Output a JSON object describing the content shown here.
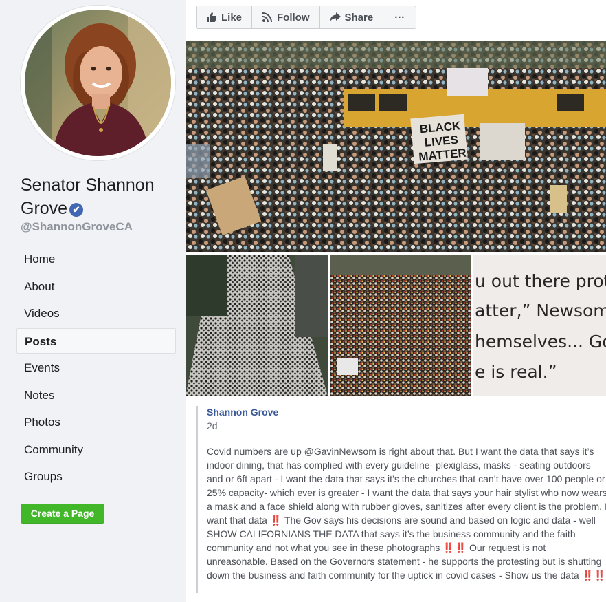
{
  "sidebar": {
    "page_name": "Senator Shannon Grove",
    "verified_badge": "✔",
    "handle": "@ShannonGroveCA",
    "nav": [
      "Home",
      "About",
      "Videos",
      "Posts",
      "Events",
      "Notes",
      "Photos",
      "Community",
      "Groups"
    ],
    "active_nav": "Posts",
    "create_page_label": "Create a Page"
  },
  "actions": {
    "like": "Like",
    "follow": "Follow",
    "share": "Share",
    "more": "···"
  },
  "photos": {
    "main_sign": [
      "BLACK",
      "LIVES",
      "MATTER"
    ],
    "quote_lines": [
      "u out there prote",
      "atter,” Newsom s",
      "hemselves... God",
      "e is real.”"
    ]
  },
  "post": {
    "author": "Shannon Grove",
    "time": "2d",
    "text": "Covid numbers are up @GavinNewsom is right about that. But I want the data that says it’s indoor dining, that has complied with every guideline- plexiglass, masks - seating outdoors and or 6ft apart - I want the data that says it’s the churches that can’t have over 100 people or 25% capacity- which ever is greater - I want the data that says your hair stylist who now wears a mask and a face shield along with rubber gloves, sanitizes after every client is the problem. I want that data ‼️ The Gov says his decisions are sound and based on logic and data - well SHOW CALIFORNIANS THE DATA that says it’s the business community and the faith community and not what you see in these photographs ‼️‼️ Our request is not unreasonable. Based on the Governors statement - he supports the protesting but is shutting down the business and faith community for the uptick in covid cases - Show us the data ‼️‼️"
  },
  "colors": {
    "sidebar_bg": "#f0f2f5",
    "link_blue": "#385898",
    "create_green": "#42b72a",
    "verified_blue": "#4267b2"
  }
}
